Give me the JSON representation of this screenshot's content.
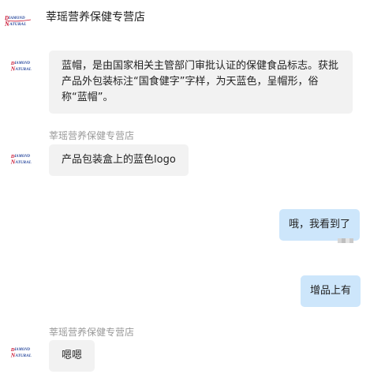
{
  "header": {
    "shop_name": "莘瑶营养保健专营店",
    "logo_text_top": "DIAMOND",
    "logo_text_bottom": "NATURAL"
  },
  "messages": [
    {
      "from": "shop",
      "text": "蓝帽，是由国家相关主管部门审批认证的保健食品标志。获批产品外包装标注“国食健字”字样，为天蓝色，呈帽形，俗称“蓝帽”。"
    },
    {
      "from": "shop",
      "sender": "莘瑶营养保健专营店",
      "text": "产品包装盒上的蓝色logo"
    },
    {
      "from": "me",
      "text": "哦，我看到了"
    },
    {
      "from": "me",
      "text": "增品上有"
    },
    {
      "from": "shop",
      "sender": "莘瑶营养保健专营店",
      "text": "嗯嗯"
    }
  ],
  "colors": {
    "shop_bubble": "#f2f2f2",
    "my_bubble": "#cde6fb",
    "sender_name": "#999999",
    "logo_red": "#c8102e",
    "logo_blue": "#2a4a9e"
  }
}
